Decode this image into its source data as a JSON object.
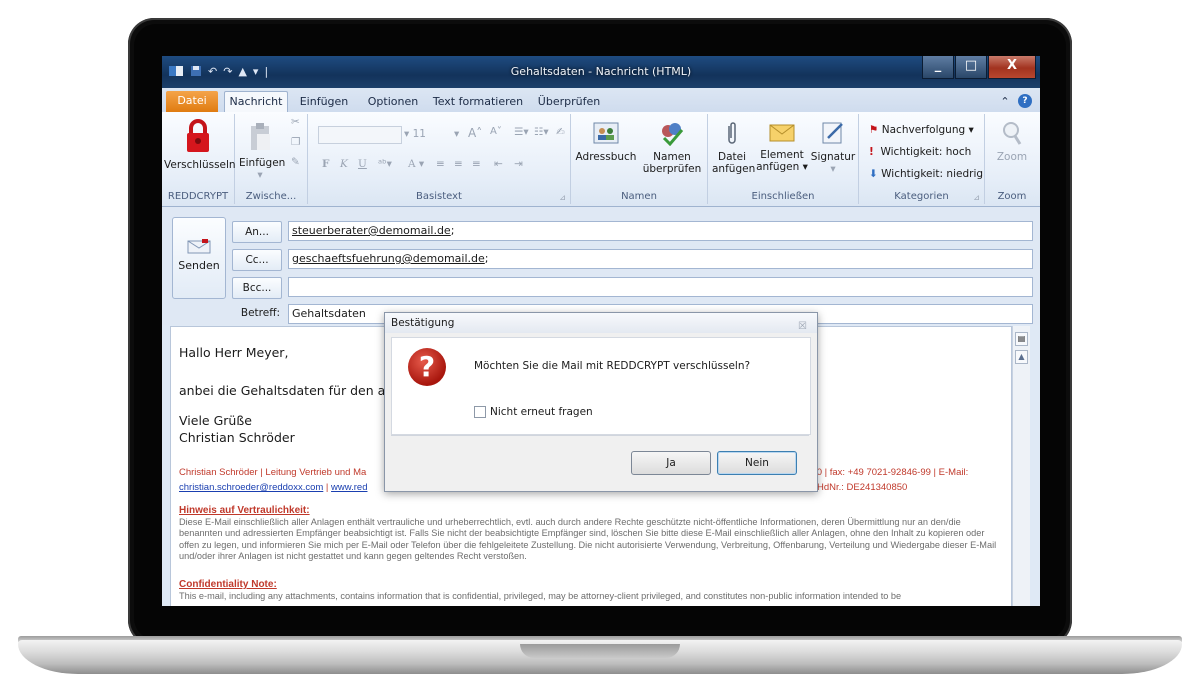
{
  "window": {
    "title": "Gehaltsdaten - Nachricht (HTML)",
    "minimize": "_",
    "maximize": "□",
    "close": "X"
  },
  "tabs": [
    "Datei",
    "Nachricht",
    "Einfügen",
    "Optionen",
    "Text formatieren",
    "Überprüfen"
  ],
  "ribbon": {
    "reddcrypt": {
      "button": "Verschlüsseln",
      "label": "REDDCRYPT"
    },
    "clipboard": {
      "button": "Einfügen",
      "label": "Zwische..."
    },
    "basictext": {
      "font_size": "11",
      "label": "Basistext"
    },
    "names": {
      "addressbook": "Adressbuch",
      "check_names_1": "Namen",
      "check_names_2": "überprüfen",
      "label": "Namen"
    },
    "include": {
      "file_1": "Datei",
      "file_2": "anfügen",
      "item_1": "Element",
      "item_2": "anfügen",
      "signature": "Signatur",
      "label": "Einschließen"
    },
    "tags": {
      "followup": "Nachverfolgung",
      "high": "Wichtigkeit: hoch",
      "low": "Wichtigkeit: niedrig",
      "label": "Kategorien"
    },
    "zoom": {
      "button": "Zoom",
      "label": "Zoom"
    }
  },
  "envelope": {
    "send": "Senden",
    "to_button": "An...",
    "cc_button": "Cc...",
    "bcc_button": "Bcc...",
    "subject_label": "Betreff:",
    "to_value": "steuerberater@demomail.de",
    "cc_value": "geschaeftsfuehrung@demomail.de",
    "bcc_value": "",
    "subject_value": "Gehaltsdaten"
  },
  "body": {
    "greeting": "Hallo Herr Meyer,",
    "line1": "anbei die Gehaltsdaten für den aktu",
    "closing1": "Viele Grüße",
    "closing2": "Christian Schröder",
    "sig_left": "Christian Schröder  |  Leitung Vertrieb und Ma",
    "sig_right": "3-30 | fax: +49 7021-92846-99 | E-Mail:",
    "sig_email": "christian.schroeder@reddoxx.com",
    "sig_web": "www.red",
    "sig_vat": "HdNr.: DE241340850",
    "hint_title": "Hinweis auf Vertraulichkeit:",
    "hint_text": "Diese E-Mail einschließlich aller Anlagen enthält vertrauliche und urheberrechtlich, evtl. auch durch andere Rechte geschützte nicht-öffentliche Informationen, deren Übermittlung nur an den/die benannten und adressierten Empfänger beabsichtigt ist. Falls Sie nicht der beabsichtigte Empfänger sind, löschen Sie bitte diese E-Mail einschließlich aller Anlagen, ohne den Inhalt zu kopieren oder offen zu legen, und informieren Sie mich per E-Mail oder Telefon über die fehlgeleitete Zustellung. Die nicht autorisierte Verwendung, Verbreitung, Offenbarung, Verteilung und Wiedergabe dieser E-Mail und/oder ihrer Anlagen ist nicht gestattet und kann gegen geltendes Recht verstoßen.",
    "conf_title": "Confidentiality Note:",
    "conf_text": "This e-mail, including any attachments, contains information that is confidential, privileged, may be attorney-client privileged, and constitutes non-public information intended to be"
  },
  "dialog": {
    "title": "Bestätigung",
    "message": "Möchten Sie die Mail mit REDDCRYPT verschlüsseln?",
    "checkbox": "Nicht erneut fragen",
    "yes": "Ja",
    "no": "Nein"
  }
}
